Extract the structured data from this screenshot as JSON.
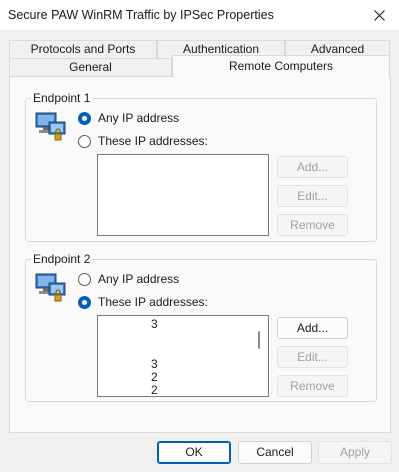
{
  "window": {
    "title": "Secure PAW WinRM Traffic by IPSec Properties"
  },
  "tabs": {
    "row1": [
      "Protocols and Ports",
      "Authentication",
      "Advanced"
    ],
    "row2": [
      "General",
      "Remote Computers"
    ]
  },
  "endpoint1": {
    "label": "Endpoint 1",
    "any_ip_label": "Any IP address",
    "these_ip_label": "These IP addresses:",
    "selected": "any",
    "add_label": "Add...",
    "edit_label": "Edit...",
    "remove_label": "Remove"
  },
  "endpoint2": {
    "label": "Endpoint 2",
    "any_ip_label": "Any IP address",
    "these_ip_label": "These IP addresses:",
    "selected": "these",
    "ip_list": [
      "3",
      "3",
      "2",
      "2"
    ],
    "add_label": "Add...",
    "edit_label": "Edit...",
    "remove_label": "Remove"
  },
  "footer": {
    "ok_label": "OK",
    "cancel_label": "Cancel",
    "apply_label": "Apply"
  },
  "colors": {
    "accent": "#005fb8",
    "background": "#f0f0f0",
    "panel": "#f9f9f9"
  }
}
